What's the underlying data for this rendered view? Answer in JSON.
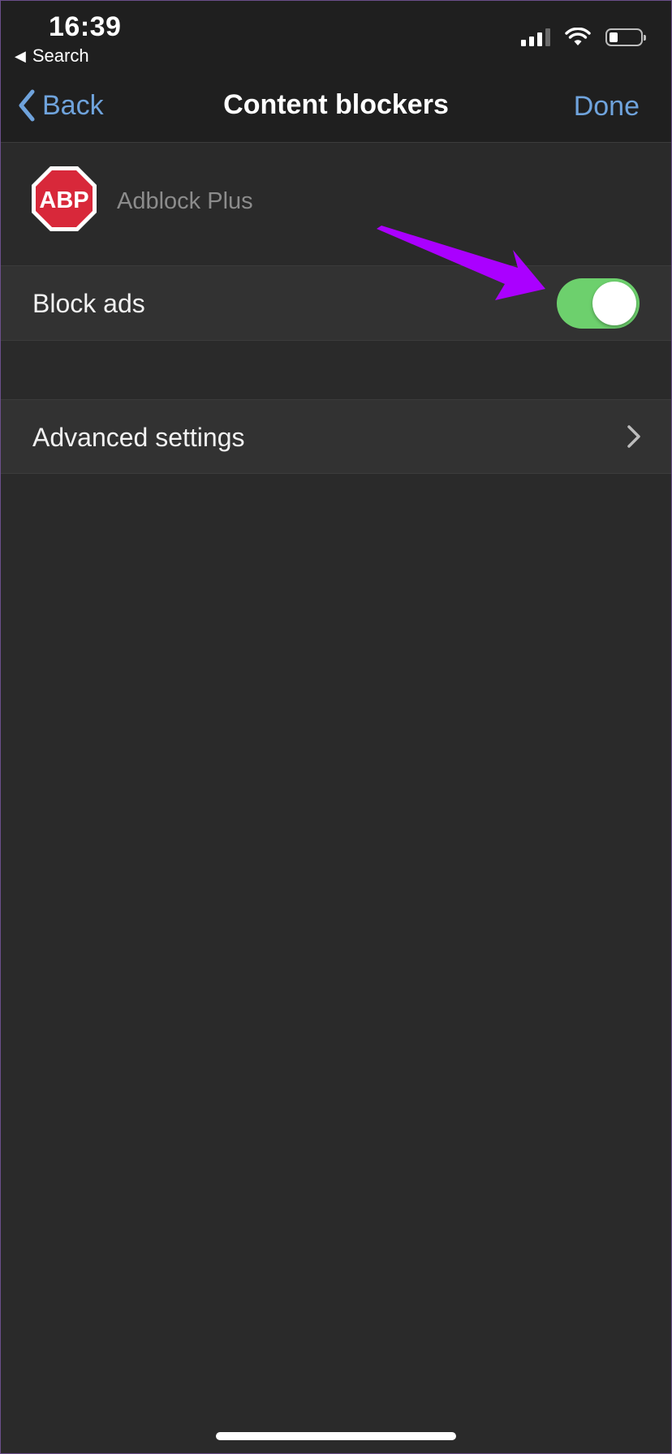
{
  "status_bar": {
    "time": "16:39",
    "back_app_label": "Search",
    "signal_bars_active": 3,
    "signal_bars_total": 4,
    "battery_level": 0.2
  },
  "nav": {
    "back_label": "Back",
    "title": "Content blockers",
    "done_label": "Done"
  },
  "app": {
    "logo_text": "ABP",
    "name": "Adblock Plus"
  },
  "settings": {
    "block_ads": {
      "label": "Block ads",
      "enabled": true
    },
    "advanced": {
      "label": "Advanced settings"
    }
  },
  "colors": {
    "accent": "#6fa3dc",
    "toggle_on": "#6dd06d",
    "logo_red": "#d8283a",
    "annotation": "#aa00ff"
  },
  "icons": [
    "chevron-left-icon",
    "play-left-icon",
    "cellular-signal-icon",
    "wifi-icon",
    "battery-icon",
    "chevron-right-icon",
    "abp-logo-icon",
    "arrow-annotation-icon"
  ]
}
